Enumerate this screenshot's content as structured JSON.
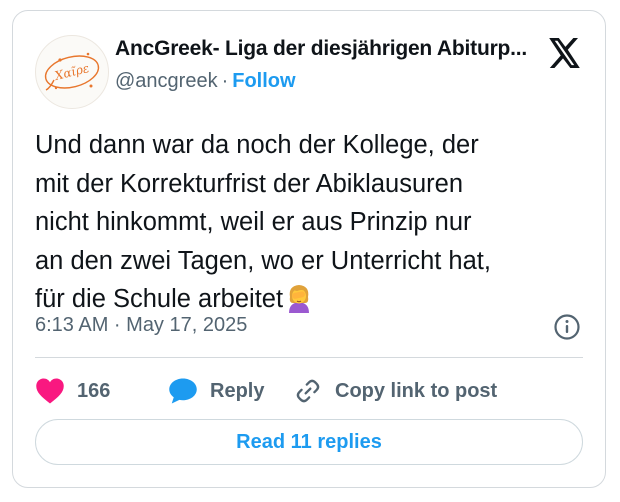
{
  "author": {
    "name": "AncGreek- Liga der diesjährigen Abiturp...",
    "handle": "@ancgreek",
    "separator": "·",
    "follow_label": "Follow",
    "avatar_text": "Χαῖρε"
  },
  "tweet": {
    "lines": [
      "Und dann war da noch der Kollege, der",
      "mit der Korrekturfrist der Abiklausuren",
      "nicht hinkommt, weil er aus Prinzip nur",
      "an den zwei Tagen, wo er Unterricht hat,",
      "für die Schule arbeitet"
    ],
    "emoji": "woman-facepalming-emoji",
    "timestamp": "6:13 AM · May 17, 2025"
  },
  "actions": {
    "like_count": "166",
    "reply_label": "Reply",
    "copy_label": "Copy link to post",
    "read_replies_label": "Read 11 replies"
  },
  "icons": {
    "x_logo": "x-logo-icon",
    "info": "info-icon",
    "like": "heart-icon",
    "reply": "speech-bubble-icon",
    "copy": "link-icon"
  },
  "colors": {
    "accent": "#1d9bf0",
    "like": "#f91880",
    "secondary_text": "#536471",
    "border": "#d4d9dd"
  }
}
